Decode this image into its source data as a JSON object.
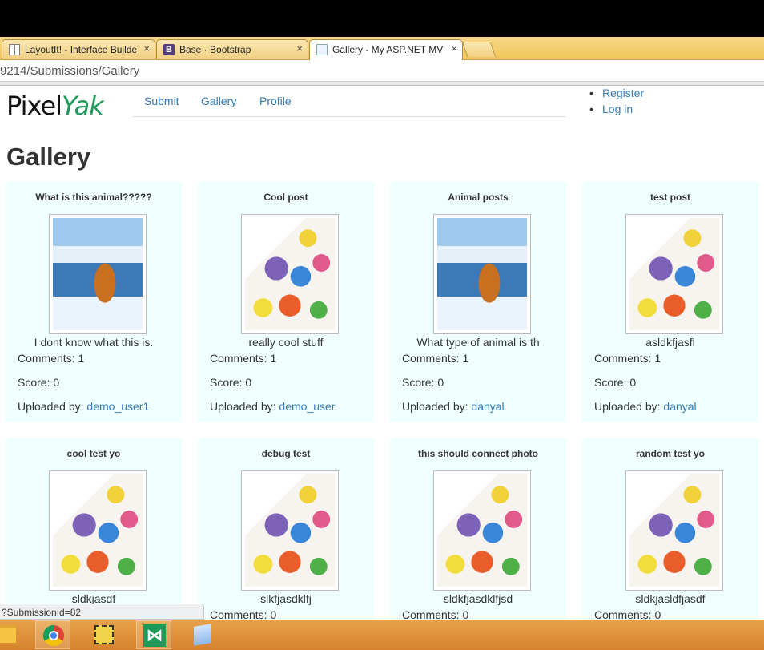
{
  "browser": {
    "tabs": [
      {
        "title": "LayoutIt! - Interface Builde",
        "close": "×",
        "icon": "grid-icon"
      },
      {
        "title": "Base · Bootstrap",
        "close": "×",
        "icon": "bootstrap-icon",
        "icon_letter": "B"
      },
      {
        "title": "Gallery - My ASP.NET MV",
        "close": "×",
        "icon": "page-icon"
      }
    ],
    "url": "9214/Submissions/Gallery"
  },
  "site": {
    "logo_pixel": "Pixel",
    "logo_yak": "Yak",
    "nav": [
      "Submit",
      "Gallery",
      "Profile"
    ],
    "account": [
      "Register",
      "Log in"
    ]
  },
  "page": {
    "title": "Gallery",
    "labels": {
      "comments": "Comments: ",
      "score": "Score: ",
      "uploaded_by": "Uploaded by: "
    }
  },
  "gallery": [
    {
      "title": "What is this animal?????",
      "image": "tiger",
      "description": "I dont know what this is.",
      "comments": "1",
      "score": "0",
      "uploader": "demo_user1"
    },
    {
      "title": "Cool post",
      "image": "pokemon",
      "description": "really cool stuff",
      "comments": "1",
      "score": "0",
      "uploader": "demo_user"
    },
    {
      "title": "Animal posts",
      "image": "tiger",
      "description": "What type of animal is th",
      "comments": "1",
      "score": "0",
      "uploader": "danyal"
    },
    {
      "title": "test post",
      "image": "pokemon",
      "description": "asldkfjasfl",
      "comments": "1",
      "score": "0",
      "uploader": "danyal"
    },
    {
      "title": "cool test yo",
      "image": "pokemon",
      "description": "sldkjasdf"
    },
    {
      "title": "debug test",
      "image": "pokemon",
      "description": "slkfjasdklfj",
      "comments": "0"
    },
    {
      "title": "this should connect photo",
      "image": "pokemon",
      "description": "sldkfjasdklfjsd",
      "comments": "0"
    },
    {
      "title": "random test yo",
      "image": "pokemon",
      "description": "sldkjasldfjasdf",
      "comments": "0"
    }
  ],
  "status_bar": "?SubmissionId=82",
  "taskbar": [
    "file-explorer-icon",
    "chrome-icon",
    "tools-icon",
    "visual-studio-icon",
    "notepad-icon"
  ],
  "colors": {
    "link": "#337ab7",
    "card_bg": "#f0ffff",
    "logo_accent": "#1f9a5a",
    "taskbar": "#d5832c"
  }
}
